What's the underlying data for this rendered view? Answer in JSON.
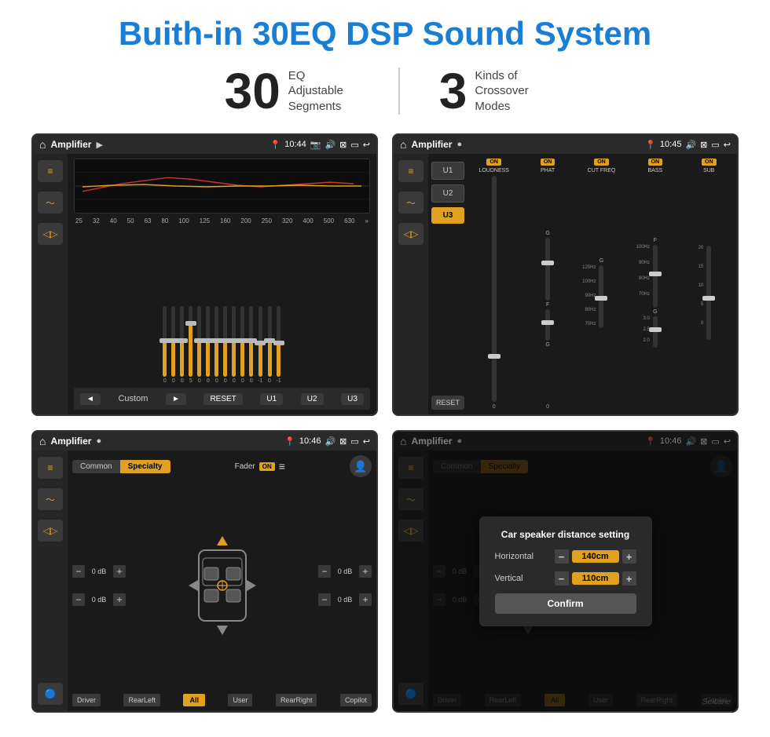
{
  "page": {
    "title": "Buith-in 30EQ DSP Sound System",
    "watermark": "Seicane"
  },
  "stats": {
    "eq": {
      "number": "30",
      "label": "EQ Adjustable\nSegments"
    },
    "crossover": {
      "number": "3",
      "label": "Kinds of\nCrossover Modes"
    }
  },
  "screen1": {
    "status_bar": {
      "title": "Amplifier",
      "time": "10:44"
    },
    "eq_bands": [
      "25",
      "32",
      "40",
      "50",
      "63",
      "80",
      "100",
      "125",
      "160",
      "200",
      "250",
      "320",
      "400",
      "500",
      "630"
    ],
    "eq_values": [
      "0",
      "0",
      "0",
      "5",
      "0",
      "0",
      "0",
      "0",
      "0",
      "0",
      "0",
      "0",
      "-1",
      "0",
      "-1"
    ],
    "bottom": {
      "prev": "◄",
      "label": "Custom",
      "next": "►",
      "reset": "RESET",
      "u1": "U1",
      "u2": "U2",
      "u3": "U3"
    }
  },
  "screen2": {
    "status_bar": {
      "title": "Amplifier",
      "time": "10:45"
    },
    "presets": [
      "U1",
      "U2",
      "U3"
    ],
    "active_preset": "U3",
    "bands": [
      {
        "label": "LOUDNESS",
        "on": true
      },
      {
        "label": "PHAT",
        "on": true
      },
      {
        "label": "CUT FREQ",
        "on": true
      },
      {
        "label": "BASS",
        "on": true
      },
      {
        "label": "SUB",
        "on": true
      }
    ],
    "reset": "RESET"
  },
  "screen3": {
    "status_bar": {
      "title": "Amplifier",
      "time": "10:46"
    },
    "tabs": [
      "Common",
      "Specialty"
    ],
    "active_tab": "Specialty",
    "fader_label": "Fader",
    "fader_on": "ON",
    "db_values": [
      "0 dB",
      "0 dB",
      "0 dB",
      "0 dB"
    ],
    "speaker_buttons": {
      "driver": "Driver",
      "copilot": "Copilot",
      "rear_left": "RearLeft",
      "all": "All",
      "user": "User",
      "rear_right": "RearRight"
    }
  },
  "screen4": {
    "status_bar": {
      "title": "Amplifier",
      "time": "10:46"
    },
    "tabs": [
      "Common",
      "Specialty"
    ],
    "dialog": {
      "title": "Car speaker distance setting",
      "horizontal_label": "Horizontal",
      "horizontal_value": "140cm",
      "vertical_label": "Vertical",
      "vertical_value": "110cm",
      "confirm_label": "Confirm"
    },
    "speaker_buttons": {
      "driver": "Driver",
      "copilot": "Copilot",
      "rear_left": "RearLeft",
      "all": "All",
      "user": "User",
      "rear_right": "RearRight"
    },
    "db_values": [
      "0 dB",
      "0 dB"
    ]
  }
}
